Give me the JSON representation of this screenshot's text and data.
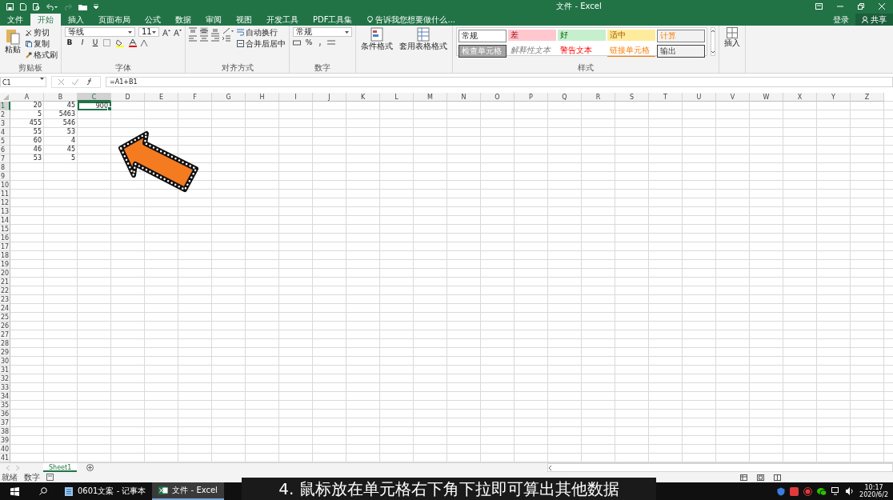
{
  "window": {
    "title": "文件 - Excel"
  },
  "tabs": [
    {
      "label": "文件",
      "selected": false
    },
    {
      "label": "开始",
      "selected": true
    },
    {
      "label": "插入",
      "selected": false
    },
    {
      "label": "页面布局",
      "selected": false
    },
    {
      "label": "公式",
      "selected": false
    },
    {
      "label": "数据",
      "selected": false
    },
    {
      "label": "审阅",
      "selected": false
    },
    {
      "label": "视图",
      "selected": false
    },
    {
      "label": "开发工具",
      "selected": false
    },
    {
      "label": "PDF工具集",
      "selected": false
    }
  ],
  "tell_me": {
    "placeholder": "告诉我您想要做什么..."
  },
  "account": {
    "sign_in": "登录",
    "share": "共享"
  },
  "ribbon": [
    {
      "kind": "clipboard",
      "label": "剪贴板",
      "large": "粘贴",
      "small": [
        "剪切",
        "复制",
        "格式刷"
      ]
    },
    {
      "kind": "font",
      "label": "字体",
      "font": "等线",
      "size": "11",
      "format_buttons": [
        "B",
        "I",
        "U"
      ]
    },
    {
      "kind": "alignment",
      "label": "对齐方式",
      "small": [
        "自动换行",
        "合并后居中"
      ]
    },
    {
      "kind": "number",
      "label": "数字",
      "format": "常规",
      "percent": "%"
    },
    {
      "kind": "table",
      "large": [
        "条件格式",
        "套用表格格式"
      ]
    },
    {
      "kind": "styles",
      "label": "样式",
      "gallery": [
        {
          "text": "常规",
          "kind": "normal"
        },
        {
          "text": "差",
          "kind": "bad"
        },
        {
          "text": "好",
          "kind": "good"
        },
        {
          "text": "适中",
          "kind": "neutral"
        },
        {
          "text": "计算",
          "kind": "calc"
        },
        {
          "text": "检查单元格",
          "kind": "check"
        },
        {
          "text": "解释性文本",
          "kind": "explanatory"
        },
        {
          "text": "警告文本",
          "kind": "warning"
        },
        {
          "text": "链接单元格",
          "kind": "linked"
        },
        {
          "text": "输出",
          "kind": "output"
        }
      ]
    },
    {
      "kind": "cells",
      "large": [
        "插入"
      ]
    }
  ],
  "formula_bar": {
    "name_box": "C1",
    "formula": "=A1+B1"
  },
  "sheet": {
    "columns": [
      {
        "label": "A",
        "selected": false
      },
      {
        "label": "B",
        "selected": false
      },
      {
        "label": "C",
        "selected": true
      },
      {
        "label": "D",
        "selected": false
      },
      {
        "label": "E",
        "selected": false
      },
      {
        "label": "F",
        "selected": false
      },
      {
        "label": "G",
        "selected": false
      },
      {
        "label": "H",
        "selected": false
      },
      {
        "label": "I",
        "selected": false
      },
      {
        "label": "J",
        "selected": false
      },
      {
        "label": "K",
        "selected": false
      },
      {
        "label": "L",
        "selected": false
      },
      {
        "label": "M",
        "selected": false
      },
      {
        "label": "N",
        "selected": false
      },
      {
        "label": "O",
        "selected": false
      },
      {
        "label": "P",
        "selected": false
      },
      {
        "label": "Q",
        "selected": false
      },
      {
        "label": "R",
        "selected": false
      },
      {
        "label": "S",
        "selected": false
      },
      {
        "label": "T",
        "selected": false
      },
      {
        "label": "U",
        "selected": false
      },
      {
        "label": "V",
        "selected": false
      },
      {
        "label": "W",
        "selected": false
      },
      {
        "label": "X",
        "selected": false
      },
      {
        "label": "Y",
        "selected": false
      },
      {
        "label": "Z",
        "selected": false
      }
    ],
    "rows": [
      {
        "number": "1",
        "selected": true,
        "cells": [
          {
            "value": "20",
            "selected": false
          },
          {
            "value": "45",
            "selected": false
          },
          {
            "value": "900",
            "selected": true
          }
        ]
      },
      {
        "number": "2",
        "selected": false,
        "cells": [
          {
            "value": "5",
            "selected": false
          },
          {
            "value": "5463",
            "selected": false
          }
        ]
      },
      {
        "number": "3",
        "selected": false,
        "cells": [
          {
            "value": "455",
            "selected": false
          },
          {
            "value": "546",
            "selected": false
          }
        ]
      },
      {
        "number": "4",
        "selected": false,
        "cells": [
          {
            "value": "55",
            "selected": false
          },
          {
            "value": "53",
            "selected": false
          }
        ]
      },
      {
        "number": "5",
        "selected": false,
        "cells": [
          {
            "value": "60",
            "selected": false
          },
          {
            "value": "4",
            "selected": false
          }
        ]
      },
      {
        "number": "6",
        "selected": false,
        "cells": [
          {
            "value": "46",
            "selected": false
          },
          {
            "value": "45",
            "selected": false
          }
        ]
      },
      {
        "number": "7",
        "selected": false,
        "cells": [
          {
            "value": "53",
            "selected": false
          },
          {
            "value": "5",
            "selected": false
          }
        ]
      },
      {
        "number": "8",
        "selected": false
      },
      {
        "number": "9",
        "selected": false
      },
      {
        "number": "10",
        "selected": false
      },
      {
        "number": "11",
        "selected": false
      },
      {
        "number": "12",
        "selected": false
      },
      {
        "number": "13",
        "selected": false
      },
      {
        "number": "14",
        "selected": false
      },
      {
        "number": "15",
        "selected": false
      },
      {
        "number": "16",
        "selected": false
      },
      {
        "number": "17",
        "selected": false
      },
      {
        "number": "18",
        "selected": false
      },
      {
        "number": "19",
        "selected": false
      },
      {
        "number": "20",
        "selected": false
      },
      {
        "number": "21",
        "selected": false
      },
      {
        "number": "22",
        "selected": false
      },
      {
        "number": "23",
        "selected": false
      },
      {
        "number": "24",
        "selected": false
      },
      {
        "number": "25",
        "selected": false
      },
      {
        "number": "26",
        "selected": false
      },
      {
        "number": "27",
        "selected": false
      },
      {
        "number": "28",
        "selected": false
      },
      {
        "number": "29",
        "selected": false
      },
      {
        "number": "30",
        "selected": false
      },
      {
        "number": "31",
        "selected": false
      },
      {
        "number": "32",
        "selected": false
      },
      {
        "number": "33",
        "selected": false
      },
      {
        "number": "34",
        "selected": false
      },
      {
        "number": "35",
        "selected": false
      },
      {
        "number": "36",
        "selected": false
      },
      {
        "number": "37",
        "selected": false
      },
      {
        "number": "38",
        "selected": false
      },
      {
        "number": "39",
        "selected": false
      },
      {
        "number": "40",
        "selected": false
      },
      {
        "number": "41",
        "selected": false
      }
    ]
  },
  "sheet_tabs": [
    {
      "label": "Sheet1",
      "selected": true
    }
  ],
  "status_bar": {
    "items": [
      "就绪",
      "数字"
    ]
  },
  "taskbar": {
    "apps": [
      {
        "label": "0601文案 - 记事本",
        "kind": "notepad",
        "selected": false
      },
      {
        "label": "文件 - Excel",
        "kind": "excel",
        "selected": true
      }
    ],
    "time": "10:17",
    "date": "2020/6/2"
  },
  "caption": "4. 鼠标放在单元格右下角下拉即可算出其他数据"
}
